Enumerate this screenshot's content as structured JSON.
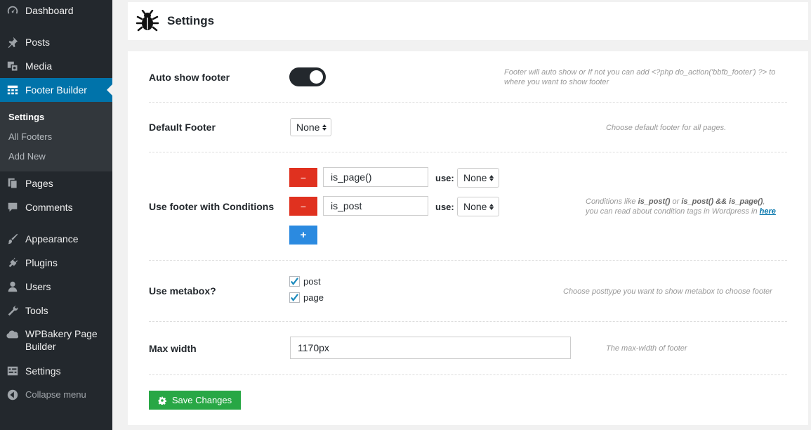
{
  "sidebar": {
    "items": {
      "dashboard": {
        "label": "Dashboard",
        "icon": "dashboard-icon"
      },
      "posts": {
        "label": "Posts",
        "icon": "pin-icon"
      },
      "media": {
        "label": "Media",
        "icon": "media-icon"
      },
      "footer_builder": {
        "label": "Footer Builder",
        "icon": "grid-icon"
      },
      "pages": {
        "label": "Pages",
        "icon": "pages-icon"
      },
      "comments": {
        "label": "Comments",
        "icon": "comment-icon"
      },
      "appearance": {
        "label": "Appearance",
        "icon": "brush-icon"
      },
      "plugins": {
        "label": "Plugins",
        "icon": "plugin-icon"
      },
      "users": {
        "label": "Users",
        "icon": "user-icon"
      },
      "tools": {
        "label": "Tools",
        "icon": "wrench-icon"
      },
      "wpbakery": {
        "label": "WPBakery Page Builder",
        "icon": "cloud-icon"
      },
      "settings": {
        "label": "Settings",
        "icon": "settings-icon"
      },
      "collapse": {
        "label": "Collapse menu",
        "icon": "collapse-icon"
      }
    },
    "submenu": {
      "settings": "Settings",
      "all_footers": "All Footers",
      "add_new": "Add New"
    },
    "accent": "#0073aa"
  },
  "header": {
    "title": "Settings",
    "icon": "bug-icon"
  },
  "form": {
    "auto_show": {
      "label": "Auto show footer",
      "enabled": true,
      "hint": "Footer will auto show or If not you can add <?php do_action('bbfb_footer') ?> to where you want to show footer"
    },
    "default_footer": {
      "label": "Default Footer",
      "value": "None",
      "hint": "Choose default footer for all pages."
    },
    "conditions": {
      "label": "Use footer with Conditions",
      "rows": [
        {
          "condition": "is_page()",
          "use_label": "use:",
          "use_value": "None"
        },
        {
          "condition": "is_post",
          "use_label": "use:",
          "use_value": "None"
        }
      ],
      "minus": "−",
      "plus": "+",
      "hint_prefix": "Conditions like ",
      "hint_code1": "is_post()",
      "hint_or": " or ",
      "hint_code2": "is_post() && is_page()",
      "hint_comma": ",",
      "hint_line2": "you can read about condition tags in Wordpress in ",
      "hint_link": "here"
    },
    "metabox": {
      "label": "Use metabox?",
      "options": [
        {
          "label": "post",
          "checked": true
        },
        {
          "label": "page",
          "checked": true
        }
      ],
      "hint": "Choose posttype you want to show metabox to choose footer"
    },
    "max_width": {
      "label": "Max width",
      "value": "1170px",
      "hint": "The max-width of footer"
    },
    "save_label": "Save Changes"
  },
  "colors": {
    "danger": "#e0311f",
    "primary": "#2b8ae0",
    "success": "#28a745"
  }
}
